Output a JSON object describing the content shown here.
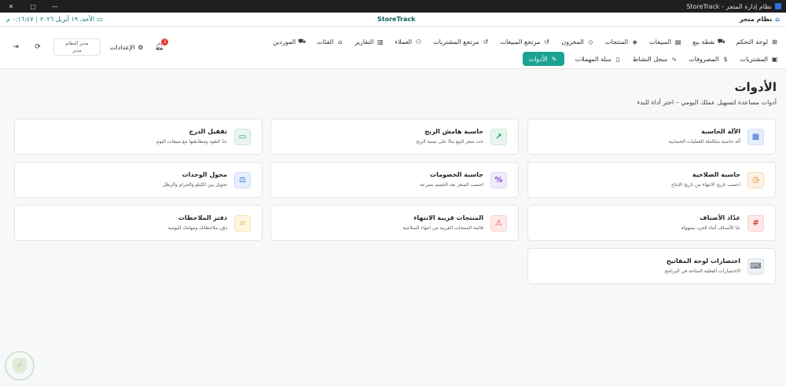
{
  "window": {
    "title": "نظام إدارة المتجر - StoreTrack",
    "controls": {
      "minimize": "—",
      "maximize": "▢",
      "close": "✕"
    }
  },
  "header": {
    "app_name": "نظام متجر",
    "brand": "StoreTrack",
    "date": "الأحد، ١٩ أبريل ٢٠٢٦",
    "time": "٠:١٦:٤٧ م"
  },
  "nav": {
    "row1": [
      {
        "label": "لوحة التحكم",
        "icon": "dashboard-icon",
        "glyph": "⊞"
      },
      {
        "label": "نقطة بيع",
        "icon": "cart-icon",
        "glyph": "⛟"
      },
      {
        "label": "المبيعات",
        "icon": "receipt-icon",
        "glyph": "▤"
      },
      {
        "label": "المنتجات",
        "icon": "box-icon",
        "glyph": "◈"
      },
      {
        "label": "المخزون",
        "icon": "warehouse-icon",
        "glyph": "◇"
      },
      {
        "label": "مرتجع المبيعات",
        "icon": "return-icon",
        "glyph": "↺"
      },
      {
        "label": "مرتجع المشتريات",
        "icon": "return-icon",
        "glyph": "↺"
      },
      {
        "label": "العملاء",
        "icon": "users-icon",
        "glyph": "⚇"
      },
      {
        "label": "التقارير",
        "icon": "report-icon",
        "glyph": "▥"
      },
      {
        "label": "الفئات",
        "icon": "tag-icon",
        "glyph": "⌂"
      },
      {
        "label": "الموردين",
        "icon": "truck-icon",
        "glyph": "⛟"
      }
    ],
    "row2": [
      {
        "label": "المشتريات",
        "icon": "bag-icon",
        "glyph": "▣"
      },
      {
        "label": "المصروفات",
        "icon": "dollar-icon",
        "glyph": "$"
      },
      {
        "label": "سجل النشاط",
        "icon": "activity-icon",
        "glyph": "∿"
      },
      {
        "label": "سلة المهملات",
        "icon": "trash-icon",
        "glyph": "▯"
      },
      {
        "label": "الأدوات",
        "icon": "wrench-icon",
        "glyph": "✎",
        "active": true
      }
    ]
  },
  "controls": {
    "settings": "الإعدادات",
    "user_role": "مدير النظام",
    "user_name": "مدير",
    "notifications": "1"
  },
  "page": {
    "title": "الأدوات",
    "subtitle": "أدوات مساعدة لتسهيل عملك اليومي – اختر أداة للبدء"
  },
  "tools": [
    {
      "title": "الآلة الحاسبة",
      "desc": "آلة حاسبة متكاملة للعمليات الحسابية",
      "icon": "calculator-icon",
      "glyph": "▦",
      "color": "blue"
    },
    {
      "title": "حاسبة هامش الربح",
      "desc": "حدد سعر البيع بناءً على نسبة الربح",
      "icon": "trending-up-icon",
      "glyph": "↗",
      "color": "green"
    },
    {
      "title": "تقفيل الدرج",
      "desc": "عدّ النقود ومطابقتها مع مبيعات اليوم",
      "icon": "cash-icon",
      "glyph": "▭",
      "color": "green"
    },
    {
      "title": "حاسبة الصلاحية",
      "desc": "احسب تاريخ الانتهاء من تاريخ الإنتاج",
      "icon": "calendar-clock-icon",
      "glyph": "◷",
      "color": "orange"
    },
    {
      "title": "حاسبة الخصومات",
      "desc": "احسب السعر بعد الخصم بسرعة",
      "icon": "percent-icon",
      "glyph": "%",
      "color": "purple"
    },
    {
      "title": "محول الوحدات",
      "desc": "تحويل بين الكيلو والجرام والرطل",
      "icon": "scale-icon",
      "glyph": "⚖",
      "color": "blue"
    },
    {
      "title": "عدّاد الأصناف",
      "desc": "عدّ الأصناف أثناء الجرد بسهولة",
      "icon": "hash-icon",
      "glyph": "#",
      "color": "red"
    },
    {
      "title": "المنتجات قريبة الانتهاء",
      "desc": "قائمة المنتجات القريبة من انتهاء الصلاحية",
      "icon": "alert-triangle-icon",
      "glyph": "⚠",
      "color": "red"
    },
    {
      "title": "دفتر الملاحظات",
      "desc": "دوّن ملاحظاتك ومهامك اليومية",
      "icon": "note-icon",
      "glyph": "▱",
      "color": "amber"
    },
    {
      "title": "اختصارات لوحة المفاتيح",
      "desc": "الاختصارات الفعلية المتاحة في البرنامج",
      "icon": "keyboard-icon",
      "glyph": "⌨",
      "color": "slate"
    }
  ]
}
